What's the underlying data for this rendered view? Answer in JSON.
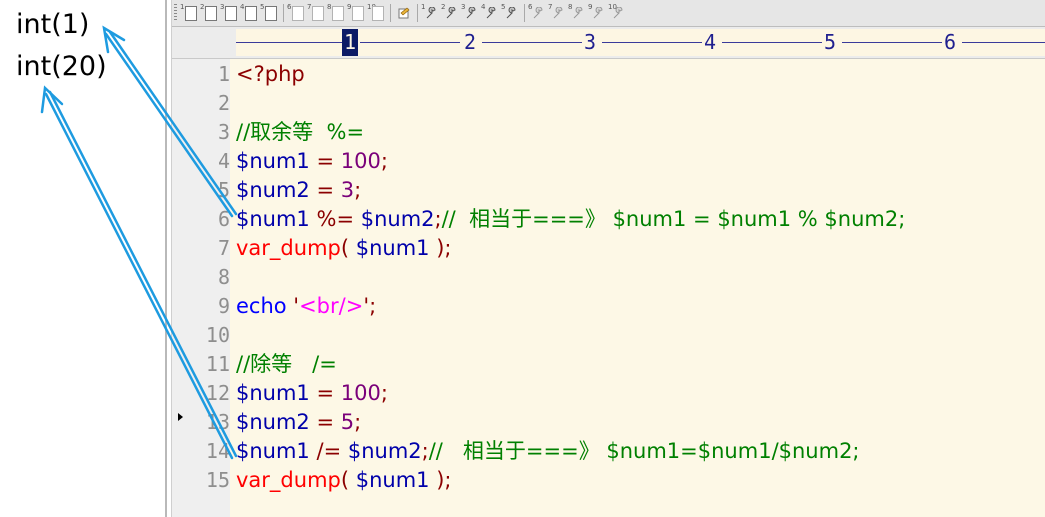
{
  "output": {
    "lines": [
      "int(1)",
      "int(20)"
    ]
  },
  "toolbar": {
    "group1_nums": [
      "1",
      "2",
      "3",
      "4",
      "5"
    ],
    "group2_nums": [
      "6",
      "7",
      "8",
      "9",
      "10"
    ],
    "group3_nums": [
      "1",
      "2",
      "3",
      "4",
      "5"
    ],
    "group4_nums": [
      "6",
      "7",
      "8",
      "9",
      "10"
    ]
  },
  "ruler": {
    "ticks": [
      "1",
      "2",
      "3",
      "4",
      "5",
      "6"
    ]
  },
  "gutter": {
    "line_numbers": [
      "1",
      "2",
      "3",
      "4",
      "5",
      "6",
      "7",
      "8",
      "9",
      "10",
      "11",
      "12",
      "13",
      "14",
      "15"
    ]
  },
  "code": {
    "l1": {
      "tag": "<?php"
    },
    "l3": {
      "comment": "//取余等  %="
    },
    "l4": {
      "var": "$num1",
      "op": " = ",
      "num": "100",
      "semi": ";"
    },
    "l5": {
      "var": "$num2",
      "op": " = ",
      "num": "3",
      "semi": ";"
    },
    "l6": {
      "var1": "$num1",
      "op": " %= ",
      "var2": "$num2",
      "semi": ";",
      "comment": "//  相当于===》 $num1 = $num1 % $num2;"
    },
    "l7": {
      "fn": "var_dump",
      "open": "( ",
      "var": "$num1",
      "close": " );"
    },
    "l9": {
      "kw": "echo",
      "q1": " '",
      "str": "<br/>",
      "q2": "';"
    },
    "l11": {
      "comment": "//除等   /="
    },
    "l12": {
      "var": "$num1",
      "op": " = ",
      "num": "100",
      "semi": ";"
    },
    "l13": {
      "var": "$num2",
      "op": " = ",
      "num": "5",
      "semi": ";"
    },
    "l14": {
      "var1": "$num1",
      "op": " /= ",
      "var2": "$num2",
      "semi": ";",
      "comment": "//   相当于===》 $num1=$num1/$num2;"
    },
    "l15": {
      "fn": "var_dump",
      "open": "( ",
      "var": "$num1",
      "close": " );"
    }
  },
  "colors": {
    "arrow": "#1e9be0",
    "comment": "#008000",
    "variable": "#0000aa",
    "number": "#7a007a",
    "function": "#ff0000",
    "keyword": "#0000ff",
    "string": "#ff00ff"
  }
}
